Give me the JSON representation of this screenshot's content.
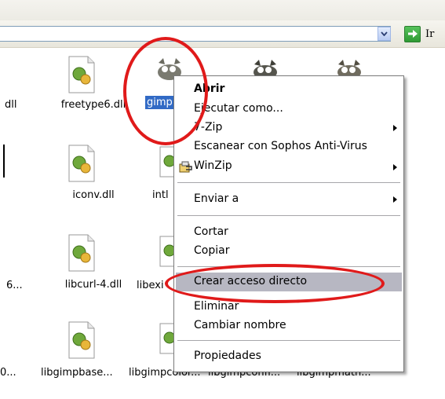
{
  "toolbar": {
    "go_label": "Ir"
  },
  "files": {
    "row1": [
      "dll",
      "freetype6.dll",
      "gimp"
    ],
    "row2": [
      "iconv.dll",
      "intl"
    ],
    "row3": [
      "6...",
      "libcurl-4.dll",
      "libexi"
    ],
    "row4": [
      "0...",
      "libgimpbase...",
      "libgimpcolor...",
      "libgimpconfi...",
      "libgimpmath..."
    ]
  },
  "context_menu": {
    "items": [
      "Abrir",
      "Ejecutar como...",
      "7-Zip",
      "Escanear con Sophos Anti-Virus",
      "WinZip",
      "Enviar a",
      "Cortar",
      "Copiar",
      "Crear acceso directo",
      "Eliminar",
      "Cambiar nombre",
      "Propiedades"
    ]
  },
  "colors": {
    "highlight": "#b7b7c2",
    "annotation_red": "#e01a1a",
    "go_green": "#3aaa3f"
  },
  "icons": [
    "dll-file-icon",
    "gimp-icon",
    "winzip-icon",
    "dropdown-chevron-icon",
    "go-arrow-icon"
  ]
}
